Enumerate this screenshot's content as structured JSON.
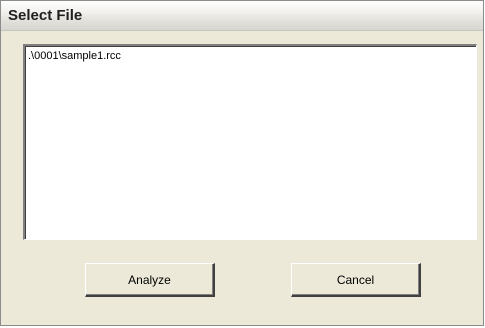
{
  "window": {
    "title": "Select File"
  },
  "file_list": {
    "items": [
      ".\\0001\\sample1.rcc"
    ]
  },
  "buttons": {
    "analyze_label": "Analyze",
    "cancel_label": "Cancel"
  }
}
